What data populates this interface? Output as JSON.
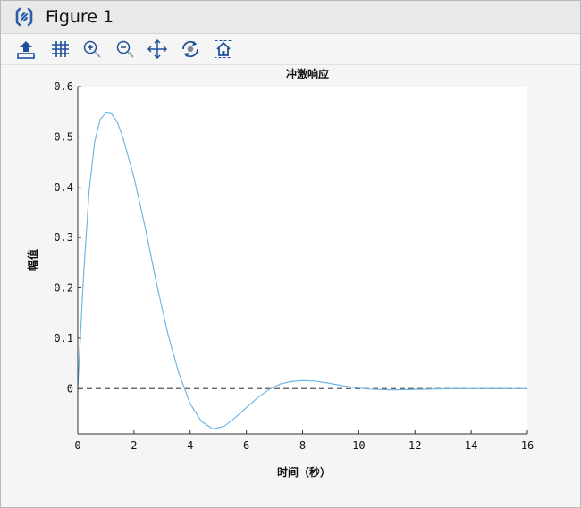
{
  "window": {
    "title": "Figure 1"
  },
  "toolbar": {
    "items": [
      {
        "name": "save-icon",
        "label": "Save"
      },
      {
        "name": "grid-icon",
        "label": "Grid"
      },
      {
        "name": "zoom-in-icon",
        "label": "Zoom in"
      },
      {
        "name": "zoom-out-icon",
        "label": "Zoom out"
      },
      {
        "name": "pan-icon",
        "label": "Pan"
      },
      {
        "name": "rotate-icon",
        "label": "Rotate"
      },
      {
        "name": "home-icon",
        "label": "Home"
      }
    ]
  },
  "chart_data": {
    "type": "line",
    "title": "冲激响应",
    "xlabel": "时间（秒）",
    "ylabel": "幅值",
    "xlim": [
      0,
      16
    ],
    "ylim": [
      -0.09,
      0.6
    ],
    "xticks": [
      0,
      2,
      4,
      6,
      8,
      10,
      12,
      14,
      16
    ],
    "yticks": [
      0,
      0.1,
      0.2,
      0.3,
      0.4,
      0.5,
      0.6
    ],
    "ytick_labels": [
      "0",
      "0.1",
      "0.2",
      "0.3",
      "0.4",
      "0.5",
      "0.6"
    ],
    "grid": false,
    "series": [
      {
        "color": "#6fb7e6",
        "x": [
          0,
          0.2,
          0.4,
          0.6,
          0.8,
          1.0,
          1.2,
          1.4,
          1.6,
          2.0,
          2.4,
          2.8,
          3.2,
          3.6,
          4.0,
          4.4,
          4.8,
          5.2,
          5.6,
          6.0,
          6.4,
          6.8,
          7.2,
          7.6,
          8.0,
          8.4,
          8.8,
          9.2,
          9.6,
          10.0,
          10.4,
          10.8,
          11.2,
          11.6,
          12.0,
          12.4,
          12.8,
          13.2,
          13.6,
          14.0,
          14.4,
          14.8,
          15.2,
          15.6,
          16.0
        ],
        "y": [
          0,
          0.22,
          0.39,
          0.49,
          0.535,
          0.548,
          0.546,
          0.53,
          0.5,
          0.42,
          0.32,
          0.21,
          0.11,
          0.03,
          -0.03,
          -0.065,
          -0.08,
          -0.075,
          -0.058,
          -0.038,
          -0.018,
          -0.002,
          0.009,
          0.014,
          0.016,
          0.015,
          0.012,
          0.008,
          0.004,
          0.001,
          -0.001,
          -0.002,
          -0.0025,
          -0.0022,
          -0.0018,
          -0.0012,
          -0.0007,
          -0.0003,
          0.0,
          0.0002,
          0.0003,
          0.0003,
          0.0002,
          0.0001,
          0.0
        ]
      }
    ],
    "reference_lines": [
      {
        "y": 0,
        "style": "dashed",
        "color": "#555555"
      }
    ]
  }
}
